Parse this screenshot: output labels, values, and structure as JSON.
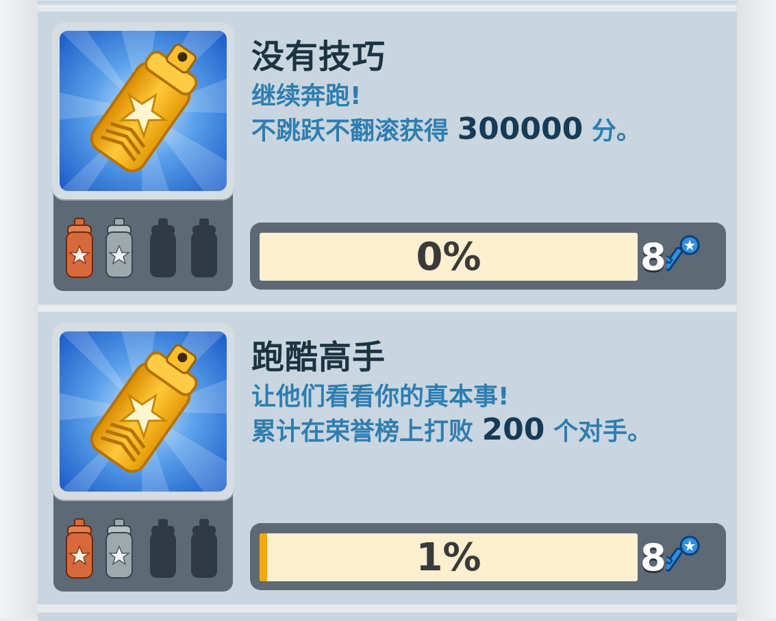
{
  "achievements": [
    {
      "title": "没有技巧",
      "desc_line1": "继续奔跑!",
      "desc_prefix": "不跳跃不翻滚获得",
      "desc_number": "300000",
      "desc_suffix": "分。",
      "progress_label": "0%",
      "progress_fraction": 0,
      "reward_count": "8",
      "reward_icon": "key-icon",
      "tiers": [
        "bronze",
        "silver",
        "locked",
        "locked"
      ]
    },
    {
      "title": "跑酷高手",
      "desc_line1": "让他们看看你的真本事!",
      "desc_prefix": "累计在荣誉榜上打败",
      "desc_number": "200",
      "desc_suffix": "个对手。",
      "progress_label": "1%",
      "progress_fraction": 0.01,
      "reward_count": "8",
      "reward_icon": "key-icon",
      "tiers": [
        "bronze",
        "silver",
        "locked",
        "locked"
      ]
    }
  ],
  "colors": {
    "card_bg": "#c9d6e0",
    "panel_dark": "#5d6975",
    "title": "#1c3342",
    "desc": "#2f7db0",
    "desc_number": "#173b56",
    "bar_bg": "#fdefcf",
    "bar_fill": "#f5a800",
    "key": "#2f8fe0",
    "bronze": "#d8693a",
    "silver": "#9fa9ad",
    "locked": "#2f3a44"
  }
}
